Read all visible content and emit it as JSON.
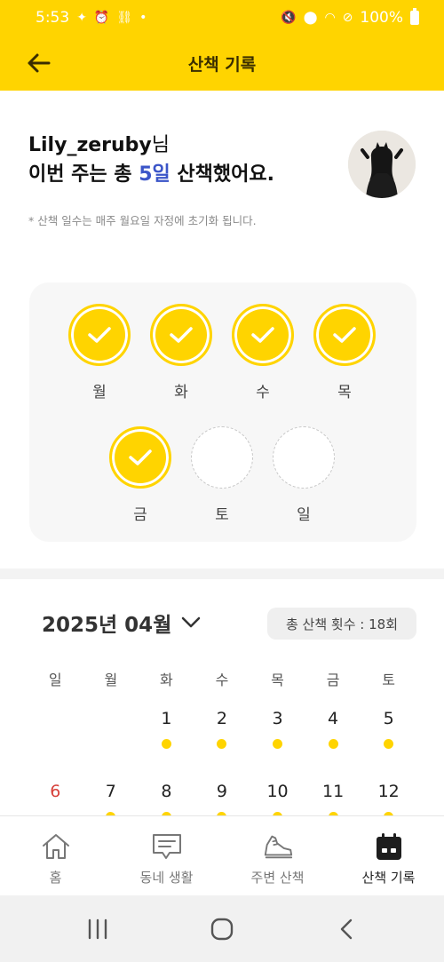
{
  "status_bar": {
    "time": "5:53",
    "battery": "100%"
  },
  "app_bar": {
    "title": "산책 기록"
  },
  "header": {
    "username": "Lily_zeruby",
    "username_suffix": "님",
    "summary_prefix": "이번 주는 총 ",
    "summary_days": "5일",
    "summary_suffix": " 산책했어요.",
    "note": "* 산책 일수는 매주 월요일 자정에 초기화 됩니다."
  },
  "week": {
    "days": [
      {
        "label": "월",
        "done": true
      },
      {
        "label": "화",
        "done": true
      },
      {
        "label": "수",
        "done": true
      },
      {
        "label": "목",
        "done": true
      },
      {
        "label": "금",
        "done": true
      },
      {
        "label": "토",
        "done": false
      },
      {
        "label": "일",
        "done": false
      }
    ]
  },
  "calendar": {
    "month_label": "2025년 04월",
    "total_label": "총 산책 횟수 : 18회",
    "weekdays": [
      "일",
      "월",
      "화",
      "수",
      "목",
      "금",
      "토"
    ],
    "weeks": [
      [
        "",
        "",
        "1",
        "2",
        "3",
        "4",
        "5"
      ],
      [
        "6",
        "7",
        "8",
        "9",
        "10",
        "11",
        "12"
      ]
    ]
  },
  "bottom_nav": {
    "items": [
      {
        "label": "홈",
        "icon": "home-icon"
      },
      {
        "label": "동네 생활",
        "icon": "chat-icon"
      },
      {
        "label": "주변 산책",
        "icon": "shoe-icon"
      },
      {
        "label": "산책 기록",
        "icon": "calendar-icon"
      }
    ],
    "active": "산책 기록"
  },
  "colors": {
    "accent": "#FFD400",
    "highlight": "#3b55c8",
    "sunday": "#d7413b"
  }
}
